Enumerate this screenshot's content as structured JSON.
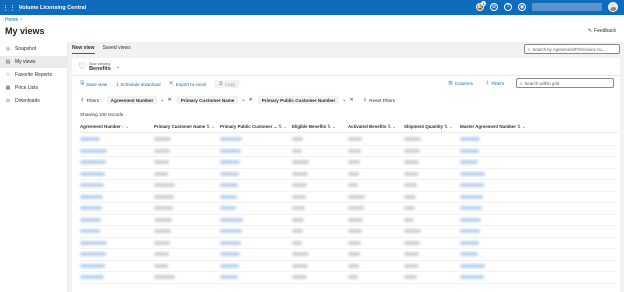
{
  "app": {
    "title": "Volume Licensing Central",
    "notification_count": "1"
  },
  "breadcrumb": {
    "home": "Home",
    "separator": "›"
  },
  "page": {
    "title": "My views",
    "feedback_label": "Feedback"
  },
  "sidebar": {
    "items": [
      {
        "label": "Snapshot",
        "icon": "snapshot-icon",
        "glyph": "◎"
      },
      {
        "label": "My views",
        "icon": "views-icon",
        "glyph": "▤",
        "active": true
      },
      {
        "label": "Favorite Reports",
        "icon": "star-icon",
        "glyph": "☆"
      },
      {
        "label": "Price Lists",
        "icon": "list-icon",
        "glyph": "▦"
      },
      {
        "label": "Downloads",
        "icon": "download-icon",
        "glyph": "⊙"
      }
    ]
  },
  "tabs": [
    {
      "label": "New view",
      "active": true
    },
    {
      "label": "Saved views",
      "active": false
    }
  ],
  "top_search": {
    "placeholder": "Search by Agreement/PO/Invoice nu..."
  },
  "viewing": {
    "caption": "Now viewing",
    "value": "Benefits"
  },
  "commands": {
    "save_view": "Save view",
    "schedule_download": "Schedule download",
    "export_excel": "Export to excel",
    "copy": "Copy",
    "columns": "Columns",
    "filters": "Filters"
  },
  "grid_search": {
    "placeholder": "Search within grid"
  },
  "filter_bar": {
    "label": "Filters :",
    "chips": [
      "Agreement Number",
      "Primary Customer Name",
      "Primary Public Customer Number"
    ],
    "reset": "Reset Filters"
  },
  "records_text": "Showing 100 records",
  "columns": [
    "Agreement Number",
    "Primary Customer Name",
    "Primary Public Customer ...",
    "Eligible Benefits",
    "Activated Benefits",
    "Shipment Quantity",
    "Master Agreement Number"
  ],
  "colors": {
    "brand": "#0f6cbd",
    "link_blur": "#b9d2ee",
    "text_blur": "#d2d0ce"
  }
}
